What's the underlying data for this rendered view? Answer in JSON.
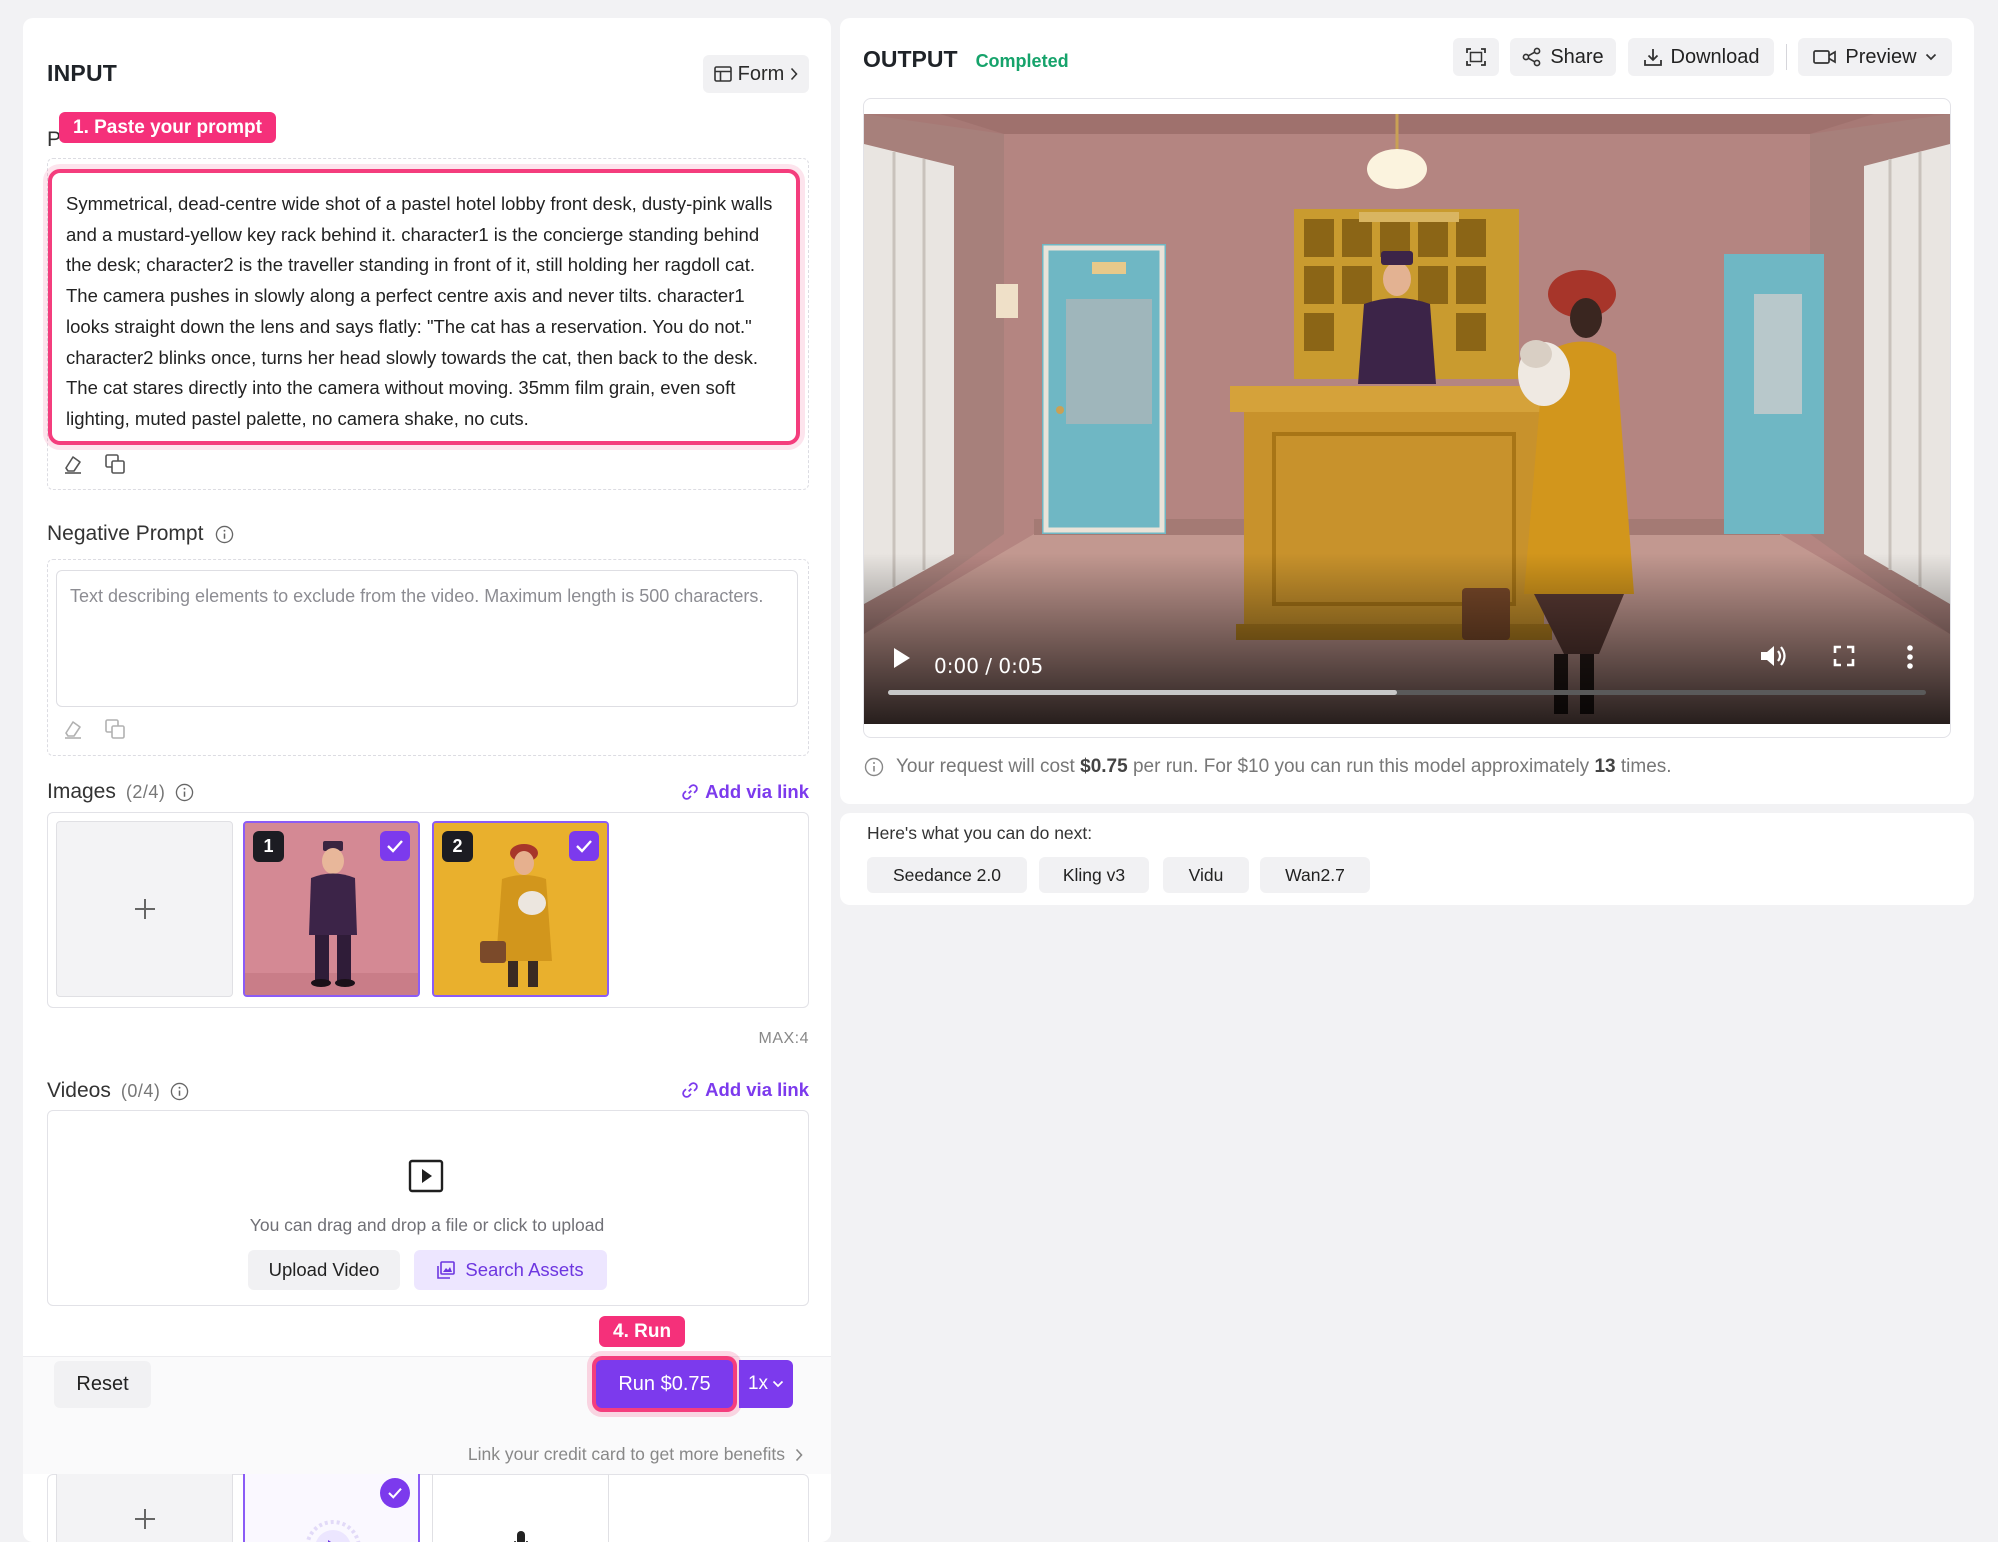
{
  "input": {
    "title": "INPUT",
    "form_button": "Form",
    "prompt_label": "P",
    "badge_paste": "1. Paste your prompt",
    "prompt_text": "Symmetrical, dead-centre wide shot of a pastel hotel lobby front desk, dusty-pink walls and a mustard-yellow key rack behind it. character1 is the concierge standing behind the desk; character2 is the traveller standing in front of it, still holding her ragdoll cat. The camera pushes in slowly along a perfect centre axis and never tilts. character1 looks straight down the lens and says flatly: \"The cat has a reservation. You do not.\" character2 blinks once, turns her head slowly towards the cat, then back to the desk. The cat stares directly into the camera without moving. 35mm film grain, even soft lighting, muted pastel palette, no camera shake, no cuts.",
    "negative_label": "Negative Prompt",
    "negative_placeholder": "Text describing elements to exclude from the video. Maximum length is 500 characters.",
    "images_label": "Images",
    "images_count": "(2/4)",
    "add_via_link": "Add via link",
    "image_thumbs": [
      {
        "num": "1",
        "checked": true
      },
      {
        "num": "2",
        "checked": true
      }
    ],
    "max_label": "MAX:4",
    "videos_label": "Videos",
    "videos_count": "(0/4)",
    "drop_text": "You can drag and drop a file or click to upload",
    "upload_video": "Upload Video",
    "search_assets": "Search Assets",
    "reset": "Reset",
    "badge_run": "4. Run",
    "run_button": "Run $0.75",
    "multiplier": "1x",
    "credit_link": "Link your credit card to get more benefits"
  },
  "output": {
    "title": "OUTPUT",
    "status": "Completed",
    "share": "Share",
    "download": "Download",
    "preview": "Preview",
    "video_time": "0:00 / 0:05",
    "video_progress_fraction": 0.49,
    "cost_prefix": "Your request will cost",
    "cost_value": "$0.75",
    "cost_mid": "per run. For $10 you can run this model approximately",
    "cost_times": "13",
    "cost_suffix": "times."
  },
  "next": {
    "title": "Here's what you can do next:",
    "models": [
      "Seedance 2.0",
      "Kling v3",
      "Vidu",
      "Wan2.7"
    ]
  },
  "colors": {
    "accent": "#7c3aed",
    "highlight": "#f43d7d",
    "status_green": "#16a36b",
    "wall_pink": "#b98a87",
    "mustard": "#d4a431"
  }
}
